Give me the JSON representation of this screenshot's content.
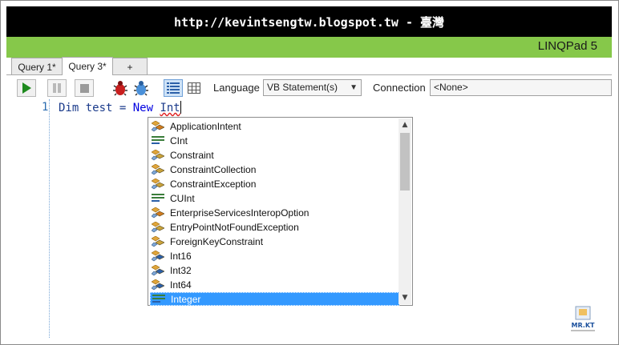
{
  "banner": {
    "text": "http://kevintsengtw.blogspot.tw - 臺灣"
  },
  "titlebar": {
    "app_name": "LINQPad 5"
  },
  "tabs": [
    {
      "label": "Query 1*"
    },
    {
      "label": "Query 3*"
    },
    {
      "label": "+"
    }
  ],
  "toolbar": {
    "language_label": "Language",
    "language_value": "VB Statement(s)",
    "connection_label": "Connection",
    "connection_value": "<None>"
  },
  "editor": {
    "line_number": "1",
    "code_prefix": "Dim test = ",
    "keyword": "New",
    "typed": "Int"
  },
  "autocomplete": {
    "items": [
      {
        "label": "ApplicationIntent",
        "icon": "enum-icon"
      },
      {
        "label": "CInt",
        "icon": "function-icon"
      },
      {
        "label": "Constraint",
        "icon": "class-icon"
      },
      {
        "label": "ConstraintCollection",
        "icon": "class-icon"
      },
      {
        "label": "ConstraintException",
        "icon": "class-icon"
      },
      {
        "label": "CUInt",
        "icon": "function-icon"
      },
      {
        "label": "EnterpriseServicesInteropOption",
        "icon": "enum-icon"
      },
      {
        "label": "EntryPointNotFoundException",
        "icon": "class-icon"
      },
      {
        "label": "ForeignKeyConstraint",
        "icon": "class-icon"
      },
      {
        "label": "Int16",
        "icon": "struct-icon"
      },
      {
        "label": "Int32",
        "icon": "struct-icon"
      },
      {
        "label": "Int64",
        "icon": "struct-icon"
      },
      {
        "label": "Integer",
        "icon": "function-icon"
      }
    ],
    "selected_index": 12
  },
  "logo": {
    "text": "MR.KT"
  },
  "colors": {
    "title_green": "#86c84a",
    "selection_blue": "#3399ff",
    "keyword_blue": "#0000e0"
  }
}
